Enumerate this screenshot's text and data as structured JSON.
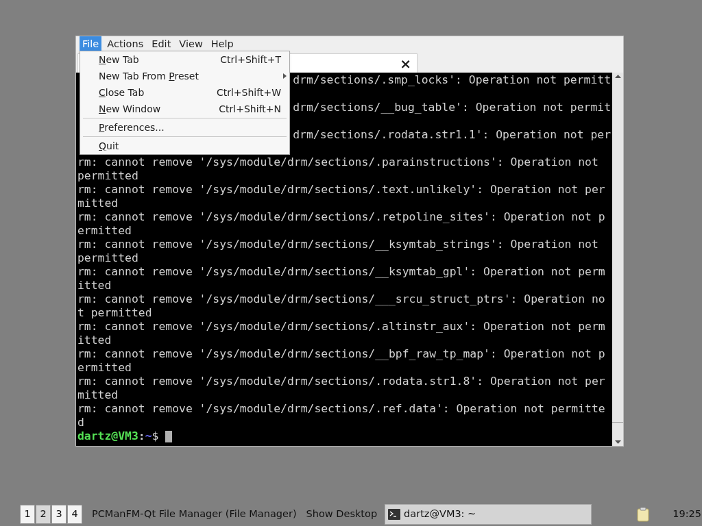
{
  "menubar": [
    {
      "label": "File",
      "selected": true
    },
    {
      "label": "Actions",
      "selected": false
    },
    {
      "label": "Edit",
      "selected": false
    },
    {
      "label": "View",
      "selected": false
    },
    {
      "label": "Help",
      "selected": false
    }
  ],
  "tab_close": "×",
  "file_menu": [
    {
      "kind": "item",
      "label": {
        "key": "N",
        "after": "ew Tab"
      },
      "shortcut": "Ctrl+Shift+T"
    },
    {
      "kind": "submenu",
      "label": {
        "before": "New Tab From ",
        "key": "P",
        "after": "reset"
      }
    },
    {
      "kind": "item",
      "label": {
        "key": "C",
        "after": "lose Tab"
      },
      "shortcut": "Ctrl+Shift+W"
    },
    {
      "kind": "item",
      "label": {
        "key": "N",
        "after": "ew Window"
      },
      "shortcut": "Ctrl+Shift+N"
    },
    {
      "kind": "separator"
    },
    {
      "kind": "item",
      "label": {
        "key": "P",
        "after": "references..."
      }
    },
    {
      "kind": "separator"
    },
    {
      "kind": "item",
      "label": {
        "key": "Q",
        "after": "uit"
      }
    }
  ],
  "terminal_lines": [
    {
      "kind": "text",
      "right": "drm/sections/.smp_locks': Operation not permitt"
    },
    {
      "kind": "covered"
    },
    {
      "kind": "text",
      "right": "drm/sections/__bug_table': Operation not permit"
    },
    {
      "kind": "covered"
    },
    {
      "kind": "text",
      "right": "drm/sections/.rodata.str1.1': Operation not per"
    },
    {
      "kind": "covered"
    },
    {
      "left": "rm: cannot remove '/sys/module/drm/sections/.parainstructions': Operation not"
    },
    {
      "left": "permitted"
    },
    {
      "left": "rm: cannot remove '/sys/module/drm/sections/.text.unlikely': Operation not per"
    },
    {
      "left": "mitted"
    },
    {
      "left": "rm: cannot remove '/sys/module/drm/sections/.retpoline_sites': Operation not p"
    },
    {
      "left": "ermitted"
    },
    {
      "left": "rm: cannot remove '/sys/module/drm/sections/__ksymtab_strings': Operation not"
    },
    {
      "left": "permitted"
    },
    {
      "left": "rm: cannot remove '/sys/module/drm/sections/__ksymtab_gpl': Operation not perm"
    },
    {
      "left": "itted"
    },
    {
      "left": "rm: cannot remove '/sys/module/drm/sections/___srcu_struct_ptrs': Operation no"
    },
    {
      "left": "t permitted"
    },
    {
      "left": "rm: cannot remove '/sys/module/drm/sections/.altinstr_aux': Operation not perm"
    },
    {
      "left": "itted"
    },
    {
      "left": "rm: cannot remove '/sys/module/drm/sections/__bpf_raw_tp_map': Operation not p"
    },
    {
      "left": "ermitted"
    },
    {
      "left": "rm: cannot remove '/sys/module/drm/sections/.rodata.str1.8': Operation not per"
    },
    {
      "left": "mitted"
    },
    {
      "left": "rm: cannot remove '/sys/module/drm/sections/.ref.data': Operation not permitte"
    },
    {
      "left": "d"
    }
  ],
  "prompt": {
    "user_host": "dartz@VM3",
    "colon": ":",
    "path": "~",
    "symbol": "$"
  },
  "taskbar": {
    "desktops": [
      {
        "label": "1",
        "selected": false
      },
      {
        "label": "2",
        "selected": true
      },
      {
        "label": "3",
        "selected": false
      },
      {
        "label": "4",
        "selected": false
      }
    ],
    "tasks": [
      {
        "kind": "plain",
        "label": "PCManFM-Qt File Manager (File Manager)"
      },
      {
        "kind": "plain",
        "label": "Show Desktop"
      },
      {
        "kind": "window",
        "label": "dartz@VM3: ~",
        "selected": true
      }
    ],
    "clock": "19:25"
  }
}
